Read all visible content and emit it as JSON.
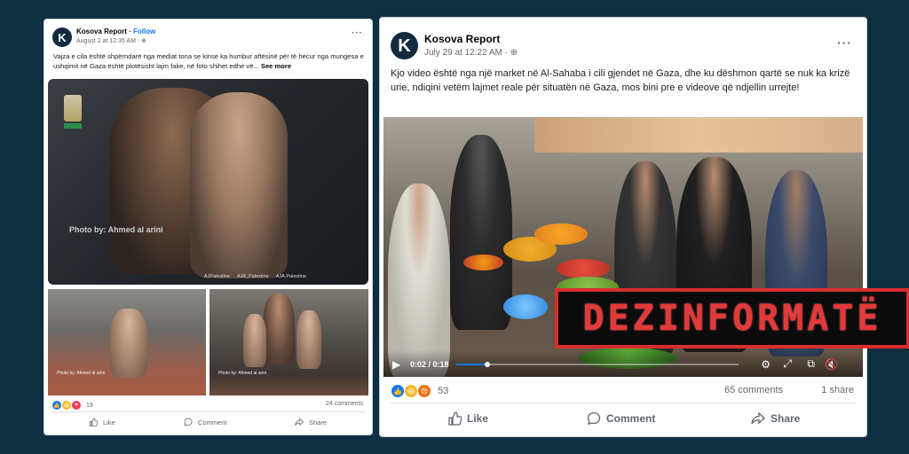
{
  "post1": {
    "page_name": "Kosova Report",
    "follow": "Follow",
    "meta": "August 2 at 12:35 AM · ",
    "caption": "Vajza e cila është shpërndarë nga mediat tona se kinse ka humbur aftësinë për të hecur nga mungesa e ushqimit në Gaza është plotësisht lajm fake, në foto shihet edhe vë...",
    "see_more": "See more",
    "photo_credit": "Photo by: Ahmed al arini",
    "photo_credit_small": "Photo by: Ahmed al arini",
    "photo_credit_small2": "Photo by: Ahmed al arini",
    "handles": [
      "AJPalestine",
      "AJA_Palestine",
      "AJA.Palestine"
    ],
    "reaction_count": "19",
    "comments": "24 comments",
    "actions": {
      "like": "Like",
      "comment": "Comment",
      "share": "Share"
    }
  },
  "post2": {
    "page_name": "Kosova Report",
    "meta": "July 29 at 12:22 AM · ",
    "caption": "Kjo video është nga një market në Al-Sahaba i cili gjendet në Gaza, dhe ku dëshmon qartë se nuk ka krizë urie, ndiqini vetëm lajmet reale për situatën në Gaza, mos bini pre e videove që ndjellin urrejte!",
    "video_time": "0:02 / 0:18",
    "video_progress": 0.11,
    "reaction_count": "53",
    "comments": "65 comments",
    "shares": "1 share",
    "actions": {
      "like": "Like",
      "comment": "Comment",
      "share": "Share"
    }
  },
  "stamp": "DEZINFORMATË",
  "avatar_letter": "K",
  "colors": {
    "background": "#0d2f40",
    "stamp_red": "#e23a3a",
    "fb_blue": "#1877f2"
  }
}
